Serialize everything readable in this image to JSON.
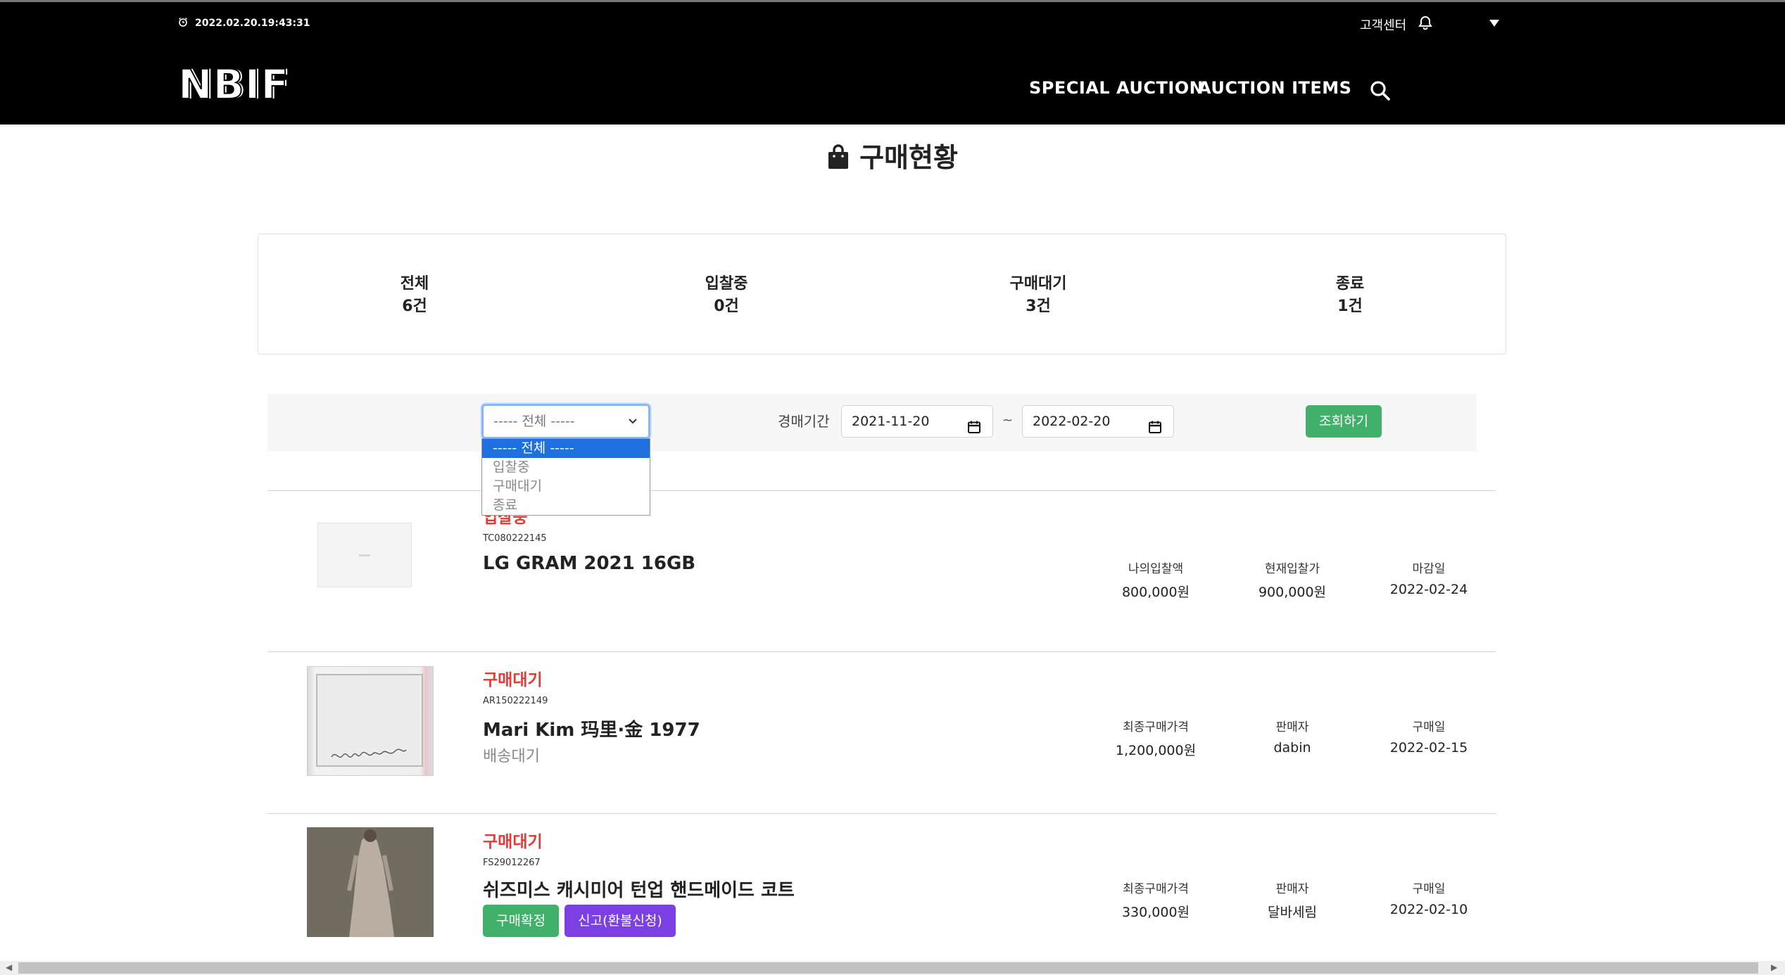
{
  "header": {
    "timestamp": "2022.02.20.19:43:31",
    "customer_center": "고객센터",
    "logo": "NBIF",
    "nav": [
      "SPECIAL AUCTION",
      "AUCTION ITEMS"
    ]
  },
  "page": {
    "title": "구매현황"
  },
  "summary": [
    {
      "label": "전체",
      "count": "6건"
    },
    {
      "label": "입찰중",
      "count": "0건"
    },
    {
      "label": "구매대기",
      "count": "3건"
    },
    {
      "label": "종료",
      "count": "1건"
    }
  ],
  "filter": {
    "selected": "----- 전체 -----",
    "options": [
      "----- 전체 -----",
      "입찰중",
      "구매대기",
      "종료"
    ],
    "period_label": "경매기간",
    "date_from": "2021-11-20",
    "date_to": "2022-02-20",
    "tilde": "~",
    "query_button": "조회하기"
  },
  "items": [
    {
      "status": "입찰중",
      "code": "TC080222145",
      "name": "LG GRAM 2021 16GB",
      "cols": [
        {
          "k": "나의입찰액",
          "v": "800,000원"
        },
        {
          "k": "현재입찰가",
          "v": "900,000원"
        },
        {
          "k": "마감일",
          "v": "2022-02-24"
        }
      ]
    },
    {
      "status": "구매대기",
      "code": "AR150222149",
      "name": "Mari Kim 玛里·金 1977",
      "sub": "배송대기",
      "cols": [
        {
          "k": "최종구매가격",
          "v": "1,200,000원"
        },
        {
          "k": "판매자",
          "v": "dabin"
        },
        {
          "k": "구매일",
          "v": "2022-02-15"
        }
      ]
    },
    {
      "status": "구매대기",
      "code": "FS29012267",
      "name": "쉬즈미스 캐시미어 턴업 핸드메이드 코트",
      "buttons": [
        "구매확정",
        "신고(환불신청)"
      ],
      "cols": [
        {
          "k": "최종구매가격",
          "v": "330,000원"
        },
        {
          "k": "판매자",
          "v": "달바세림"
        },
        {
          "k": "구매일",
          "v": "2022-02-10"
        }
      ]
    }
  ],
  "colors": {
    "status_red": "#e53935",
    "confirm_green": "#40b06a",
    "report_purple": "#7b3fe4",
    "select_highlight": "#1e6fe0"
  }
}
